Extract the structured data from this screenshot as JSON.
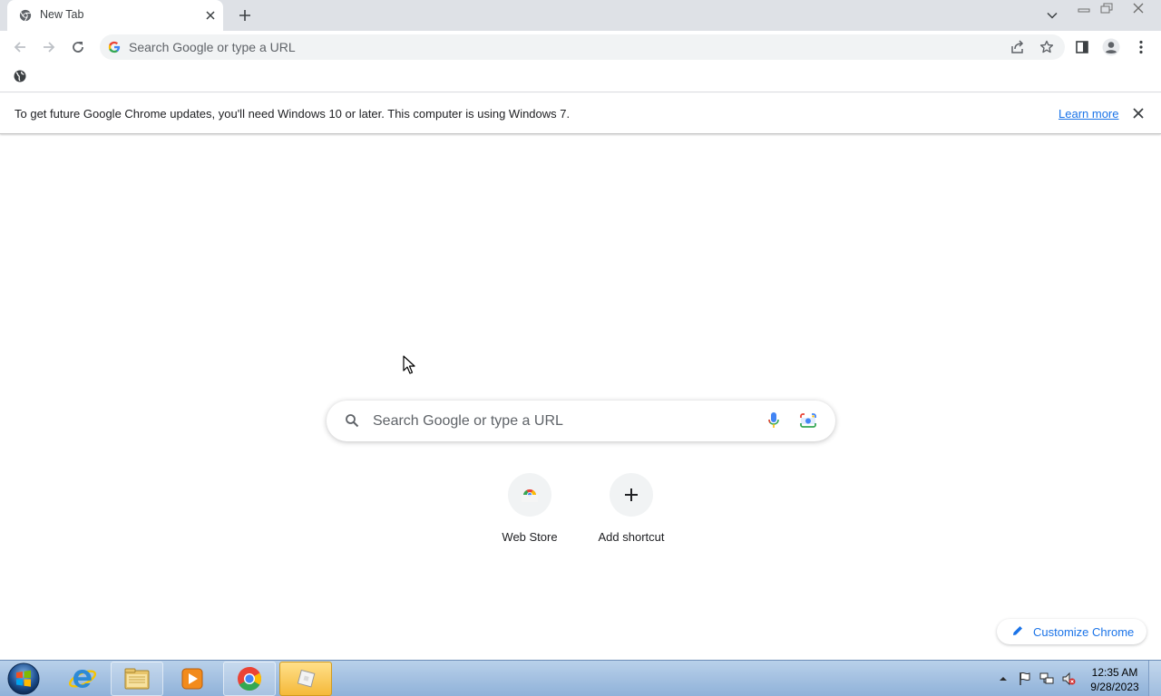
{
  "window": {
    "tab": {
      "title": "New Tab"
    },
    "icons": {
      "favicon": "chrome-icon",
      "close": "close-icon",
      "new_tab": "plus-icon",
      "tab_search": "chevron-down-icon",
      "minimize": "minimize-icon",
      "maximize": "restore-icon",
      "window_close": "close-icon"
    }
  },
  "toolbar": {
    "omnibox_placeholder": "Search Google or type a URL",
    "icons": [
      "back-icon",
      "forward-icon",
      "reload-icon",
      "google-g-icon",
      "share-icon",
      "star-icon",
      "side-panel-icon",
      "profile-icon",
      "menu-icon"
    ]
  },
  "bookmarks": {
    "items": [
      {
        "icon": "globe-icon"
      }
    ]
  },
  "infobar": {
    "message": "To get future Google Chrome updates, you'll need Windows 10 or later. This computer is using Windows 7.",
    "link": "Learn more"
  },
  "ntp": {
    "search_placeholder": "Search Google or type a URL",
    "shortcuts": [
      {
        "label": "Web Store",
        "icon": "chrome-web-store-icon"
      },
      {
        "label": "Add shortcut",
        "icon": "plus-icon"
      }
    ],
    "customize_label": "Customize Chrome"
  },
  "taskbar": {
    "apps": [
      "windows-start-icon",
      "internet-explorer-icon",
      "file-explorer-icon",
      "windows-media-player-icon",
      "chrome-icon",
      "roblox-icon"
    ],
    "tray": [
      "show-hidden-icons",
      "action-center-flag-icon",
      "network-icon",
      "volume-muted-icon"
    ],
    "clock": {
      "time": "12:35 AM",
      "date": "9/28/2023"
    }
  },
  "colors": {
    "accent": "#1a73e8",
    "tabstrip": "#dee1e6",
    "omnibox": "#f1f3f4",
    "taskbar": "#a6c2e2"
  }
}
